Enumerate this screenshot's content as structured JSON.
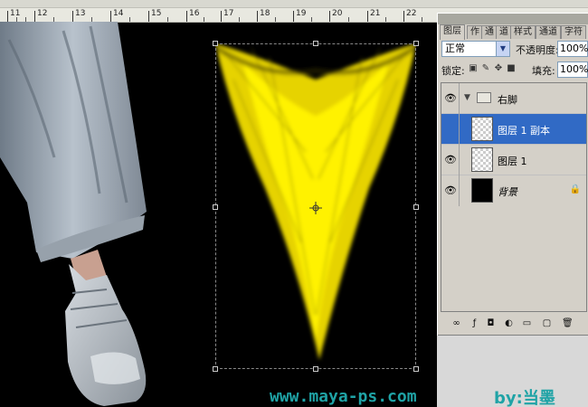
{
  "ruler": {
    "ticks": [
      "11",
      "12",
      "13",
      "14",
      "15",
      "16",
      "17",
      "18",
      "19",
      "20",
      "21",
      "22"
    ]
  },
  "layers_panel": {
    "tabs": [
      "图层",
      "作",
      "通",
      "道",
      "样式",
      "通道",
      "字符"
    ],
    "blend_mode": "正常",
    "opacity_label": "不透明度:",
    "opacity_value": "100%",
    "lock_label": "锁定:",
    "fill_label": "填充:",
    "fill_value": "100%",
    "layers": [
      {
        "name": "右脚",
        "type": "group"
      },
      {
        "name": "图层 1 副本",
        "type": "layer",
        "selected": true
      },
      {
        "name": "图层 1",
        "type": "layer"
      },
      {
        "name": "背景",
        "type": "background",
        "locked": true
      }
    ]
  },
  "watermark": {
    "url": "www.maya-ps.com",
    "byline": "by:当墨"
  },
  "colors": {
    "accent": "#1fa3a6",
    "selection": "#316ac5",
    "flame": "#ffee00"
  }
}
